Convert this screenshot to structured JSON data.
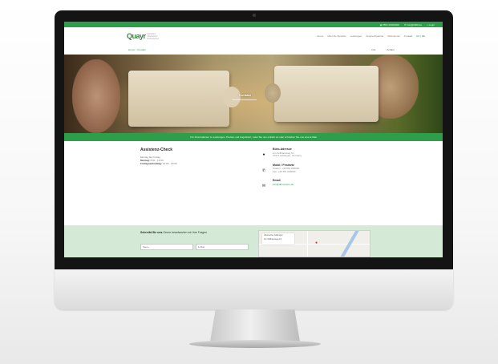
{
  "topbar": {
    "items": [
      "◆ 0551 00000000",
      "✉ info@0000.de",
      "⌂ Login"
    ]
  },
  "header": {
    "logo_mark": "Quayr",
    "logo_sub": "Sprachen Übersetzen Dolmetschen",
    "nav": [
      {
        "label": "Home",
        "active": false
      },
      {
        "label": "Über die Sprache",
        "active": false
      },
      {
        "label": "Leistungen",
        "active": false
      },
      {
        "label": "Ansprechpartner",
        "active": false
      },
      {
        "label": "Referenzen",
        "active": false
      },
      {
        "label": "Kontakt",
        "active": false
      },
      {
        "label": "EN | DE",
        "active": true
      }
    ]
  },
  "subbar": {
    "crumb": "Home > Kontakt",
    "tabs": [
      "Info",
      "Anfahrt"
    ]
  },
  "hero": {
    "title": "Kontakt"
  },
  "banner": {
    "text": "Für Informationen zu Leistungen, Preisen und Angeboten, rufen Sie uns einfach an oder schreiben Sie uns eine E-Mail"
  },
  "info_left": {
    "title": "Assistenz-Check",
    "line1": "Montag bis Freitag",
    "line2_label": "Montag:",
    "line2_value": "8:00 - 12:00",
    "line3_label": "Freitagnachmittag:",
    "line3_value": "13:00 - 18:00"
  },
  "info_right": [
    {
      "icon": "map-pin-icon",
      "glyph": "●",
      "title": "Büro-Adresse",
      "lines": [
        "Am Zollhausweg 10",
        "37077 Göttingen, Germany"
      ],
      "green": false
    },
    {
      "icon": "phone-icon",
      "glyph": "✆",
      "title": "Mobil / Festnetz",
      "lines": [
        "Telefon: +49 551 000000",
        "Fax: +49 551 000000"
      ],
      "green": false
    },
    {
      "icon": "envelope-icon",
      "glyph": "✉",
      "title": "Email",
      "lines": [
        "info@übersetzer.de"
      ],
      "green": true
    }
  ],
  "contact": {
    "title_bold": "Schreibt Sie uns",
    "title_rest": "Gerne beantworten wir Ihre Fragen",
    "field1_placeholder": "Name",
    "field2_placeholder": "E-Mail",
    "map_card_line1": "Übersetzer Göttingen",
    "map_card_line2": "Am Zollhausweg 10"
  },
  "colors": {
    "brand_green": "#2e9e4a",
    "contact_bg": "#d4ead6"
  }
}
